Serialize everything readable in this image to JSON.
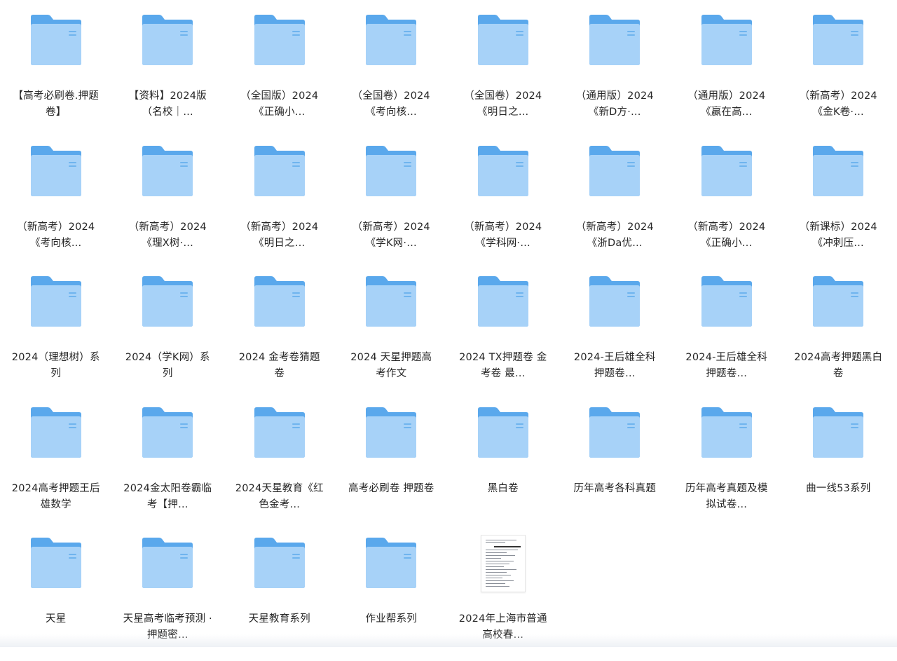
{
  "colors": {
    "folder_back": "#5aa8ec",
    "folder_front": "#a7d2f8",
    "label_text": "#262626"
  },
  "items": [
    {
      "type": "folder",
      "icon": "folder-icon",
      "label": "【高考必刷卷.押题卷】"
    },
    {
      "type": "folder",
      "icon": "folder-icon",
      "label": "【资料】2024版（名校｜…"
    },
    {
      "type": "folder",
      "icon": "folder-icon",
      "label": "（全国版）2024《正确小…"
    },
    {
      "type": "folder",
      "icon": "folder-icon",
      "label": "（全国卷）2024《考向核…"
    },
    {
      "type": "folder",
      "icon": "folder-icon",
      "label": "（全国卷）2024《明日之…"
    },
    {
      "type": "folder",
      "icon": "folder-icon",
      "label": "（通用版）2024《新D方·…"
    },
    {
      "type": "folder",
      "icon": "folder-icon",
      "label": "（通用版）2024《赢在高…"
    },
    {
      "type": "folder",
      "icon": "folder-icon",
      "label": "（新高考）2024《金K卷·…"
    },
    {
      "type": "folder",
      "icon": "folder-icon",
      "label": "（新高考）2024《考向核…"
    },
    {
      "type": "folder",
      "icon": "folder-icon",
      "label": "（新高考）2024《理X树·…"
    },
    {
      "type": "folder",
      "icon": "folder-icon",
      "label": "（新高考）2024《明日之…"
    },
    {
      "type": "folder",
      "icon": "folder-icon",
      "label": "（新高考）2024《学K网·…"
    },
    {
      "type": "folder",
      "icon": "folder-icon",
      "label": "（新高考）2024《学科网·…"
    },
    {
      "type": "folder",
      "icon": "folder-icon",
      "label": "（新高考）2024《浙Da优…"
    },
    {
      "type": "folder",
      "icon": "folder-icon",
      "label": "（新高考）2024《正确小…"
    },
    {
      "type": "folder",
      "icon": "folder-icon",
      "label": "（新课标）2024《冲刺压…"
    },
    {
      "type": "folder",
      "icon": "folder-icon",
      "label": "2024（理想树）系列"
    },
    {
      "type": "folder",
      "icon": "folder-icon",
      "label": "2024（学K网）系列"
    },
    {
      "type": "folder",
      "icon": "folder-icon",
      "label": "2024 金考卷猜题卷"
    },
    {
      "type": "folder",
      "icon": "folder-icon",
      "label": "2024 天星押题高考作文"
    },
    {
      "type": "folder",
      "icon": "folder-icon",
      "label": "2024 TX押题卷 金考卷 最…"
    },
    {
      "type": "folder",
      "icon": "folder-icon",
      "label": "2024-王后雄全科押题卷…"
    },
    {
      "type": "folder",
      "icon": "folder-icon",
      "label": "2024-王后雄全科押题卷…"
    },
    {
      "type": "folder",
      "icon": "folder-icon",
      "label": "2024高考押题黑白卷"
    },
    {
      "type": "folder",
      "icon": "folder-icon",
      "label": "2024高考押题王后雄数学"
    },
    {
      "type": "folder",
      "icon": "folder-icon",
      "label": "2024金太阳卷霸临考【押…"
    },
    {
      "type": "folder",
      "icon": "folder-icon",
      "label": "2024天星教育《红色金考…"
    },
    {
      "type": "folder",
      "icon": "folder-icon",
      "label": "高考必刷卷 押题卷"
    },
    {
      "type": "folder",
      "icon": "folder-icon",
      "label": "黑白卷"
    },
    {
      "type": "folder",
      "icon": "folder-icon",
      "label": "历年高考各科真题"
    },
    {
      "type": "folder",
      "icon": "folder-icon",
      "label": "历年高考真题及模拟试卷…"
    },
    {
      "type": "folder",
      "icon": "folder-icon",
      "label": "曲一线53系列"
    },
    {
      "type": "folder",
      "icon": "folder-icon",
      "label": "天星"
    },
    {
      "type": "folder",
      "icon": "folder-icon",
      "label": "天星高考临考预测 · 押题密…"
    },
    {
      "type": "folder",
      "icon": "folder-icon",
      "label": "天星教育系列"
    },
    {
      "type": "folder",
      "icon": "folder-icon",
      "label": "作业帮系列"
    },
    {
      "type": "document",
      "icon": "document-thumbnail-icon",
      "label": "2024年上海市普通高校春…"
    }
  ]
}
